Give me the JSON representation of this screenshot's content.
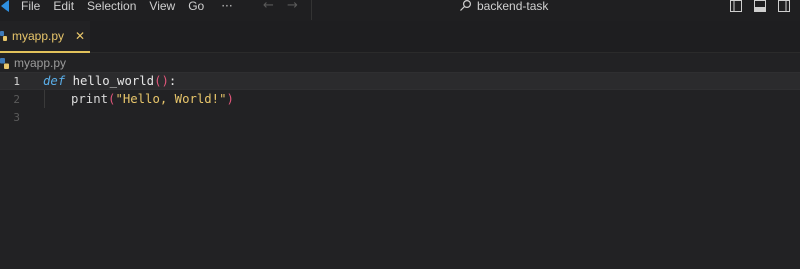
{
  "menu": {
    "items": [
      "File",
      "Edit",
      "Selection",
      "View",
      "Go"
    ],
    "more": "···"
  },
  "search": {
    "text": "backend-task",
    "icon": "search-icon"
  },
  "tab": {
    "label": "myapp.py",
    "close": "✕"
  },
  "breadcrumb": {
    "file": "myapp.py"
  },
  "editor": {
    "line_numbers": [
      "1",
      "2",
      "3"
    ],
    "line1": {
      "kw": "def",
      "name": "hello_world",
      "open": "(",
      "close": ")",
      "colon": ":"
    },
    "line2": {
      "builtin": "print",
      "open": "(",
      "str": "\"Hello, World!\"",
      "close": ")"
    }
  },
  "colors": {
    "accent": "#e8c66b",
    "keyword": "#5aaee8",
    "paren": "#e0567a"
  }
}
